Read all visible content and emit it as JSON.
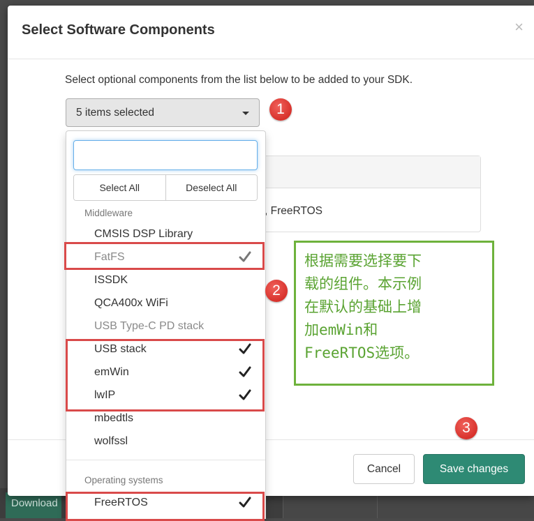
{
  "background": {
    "download_label": "Download"
  },
  "modal": {
    "title": "Select Software Components",
    "close_symbol": "×",
    "intro": "Select optional components from the list below to be added to your SDK.",
    "select_value": "5 items selected",
    "panel_text": ", FreeRTOS",
    "cancel_label": "Cancel",
    "save_label": "Save changes"
  },
  "dropdown": {
    "search_value": "",
    "select_all_label": "Select All",
    "deselect_all_label": "Deselect All",
    "groups": [
      {
        "label": "Middleware",
        "items": [
          {
            "label": "CMSIS DSP Library",
            "checked": false,
            "disabled": false
          },
          {
            "label": "FatFS",
            "checked": true,
            "disabled": true
          },
          {
            "label": "ISSDK",
            "checked": false,
            "disabled": false
          },
          {
            "label": "QCA400x WiFi",
            "checked": false,
            "disabled": false
          },
          {
            "label": "USB Type-C PD stack",
            "checked": false,
            "disabled": true
          },
          {
            "label": "USB stack",
            "checked": true,
            "disabled": false
          },
          {
            "label": "emWin",
            "checked": true,
            "disabled": false
          },
          {
            "label": "lwIP",
            "checked": true,
            "disabled": false
          },
          {
            "label": "mbedtls",
            "checked": false,
            "disabled": false
          },
          {
            "label": "wolfssl",
            "checked": false,
            "disabled": false
          }
        ]
      },
      {
        "label": "Operating systems",
        "items": [
          {
            "label": "FreeRTOS",
            "checked": true,
            "disabled": false
          }
        ]
      }
    ]
  },
  "annotations": {
    "badges": [
      "1",
      "2",
      "3"
    ],
    "note": "根据需要选择要下\n载的组件。本示例\n在默认的基础上增\n加emWin和\nFreeRTOS选项。"
  },
  "colors": {
    "save_button": "#2e8a74",
    "annotation_red": "#d94a4a",
    "note_green": "#6eb23c",
    "note_text": "#5aa332",
    "focus_blue": "#66afe9"
  },
  "icons": {
    "close": "close-icon",
    "caret": "caret-down-icon",
    "check": "check-icon"
  }
}
